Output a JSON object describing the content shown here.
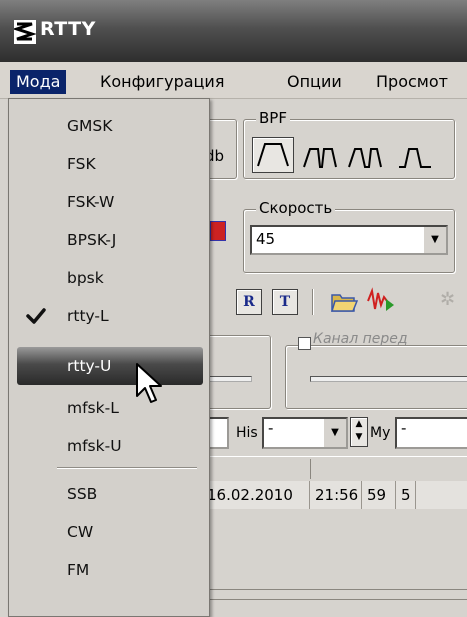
{
  "window": {
    "title": "RTTY",
    "icon": "rtty-app-icon"
  },
  "menubar": {
    "items": [
      "Мода",
      "Конфигурация",
      "Опции",
      "Просмот"
    ]
  },
  "mode_menu": {
    "items": [
      {
        "label": "GMSK",
        "checked": false,
        "highlighted": false
      },
      {
        "label": "FSK",
        "checked": false,
        "highlighted": false
      },
      {
        "label": "FSK-W",
        "checked": false,
        "highlighted": false
      },
      {
        "label": "BPSK-J",
        "checked": false,
        "highlighted": false
      },
      {
        "label": "bpsk",
        "checked": false,
        "highlighted": false
      },
      {
        "label": "rtty-L",
        "checked": true,
        "highlighted": false
      },
      {
        "label": "rtty-U",
        "checked": false,
        "highlighted": true
      },
      {
        "label": "mfsk-L",
        "checked": false,
        "highlighted": false
      },
      {
        "label": "mfsk-U",
        "checked": false,
        "highlighted": false
      },
      {
        "label": "SSB",
        "checked": false,
        "highlighted": false
      },
      {
        "label": "CW",
        "checked": false,
        "highlighted": false
      },
      {
        "label": "FM",
        "checked": false,
        "highlighted": false
      }
    ]
  },
  "toolbar": {
    "db_label": "db",
    "bpf_label": "BPF",
    "speed_label": "Скорость",
    "speed_value": "45",
    "tx_channel_label": "Канал перед",
    "his_label": "His",
    "his_value": "-",
    "my_label": "My",
    "my_value": "-"
  },
  "log_row": {
    "date": "16.02.2010",
    "time": "21:56",
    "rst1": "59",
    "rst2": "5"
  },
  "colors": {
    "menu_highlight": "#0a246a",
    "title_bar": "#3a3a3a"
  }
}
